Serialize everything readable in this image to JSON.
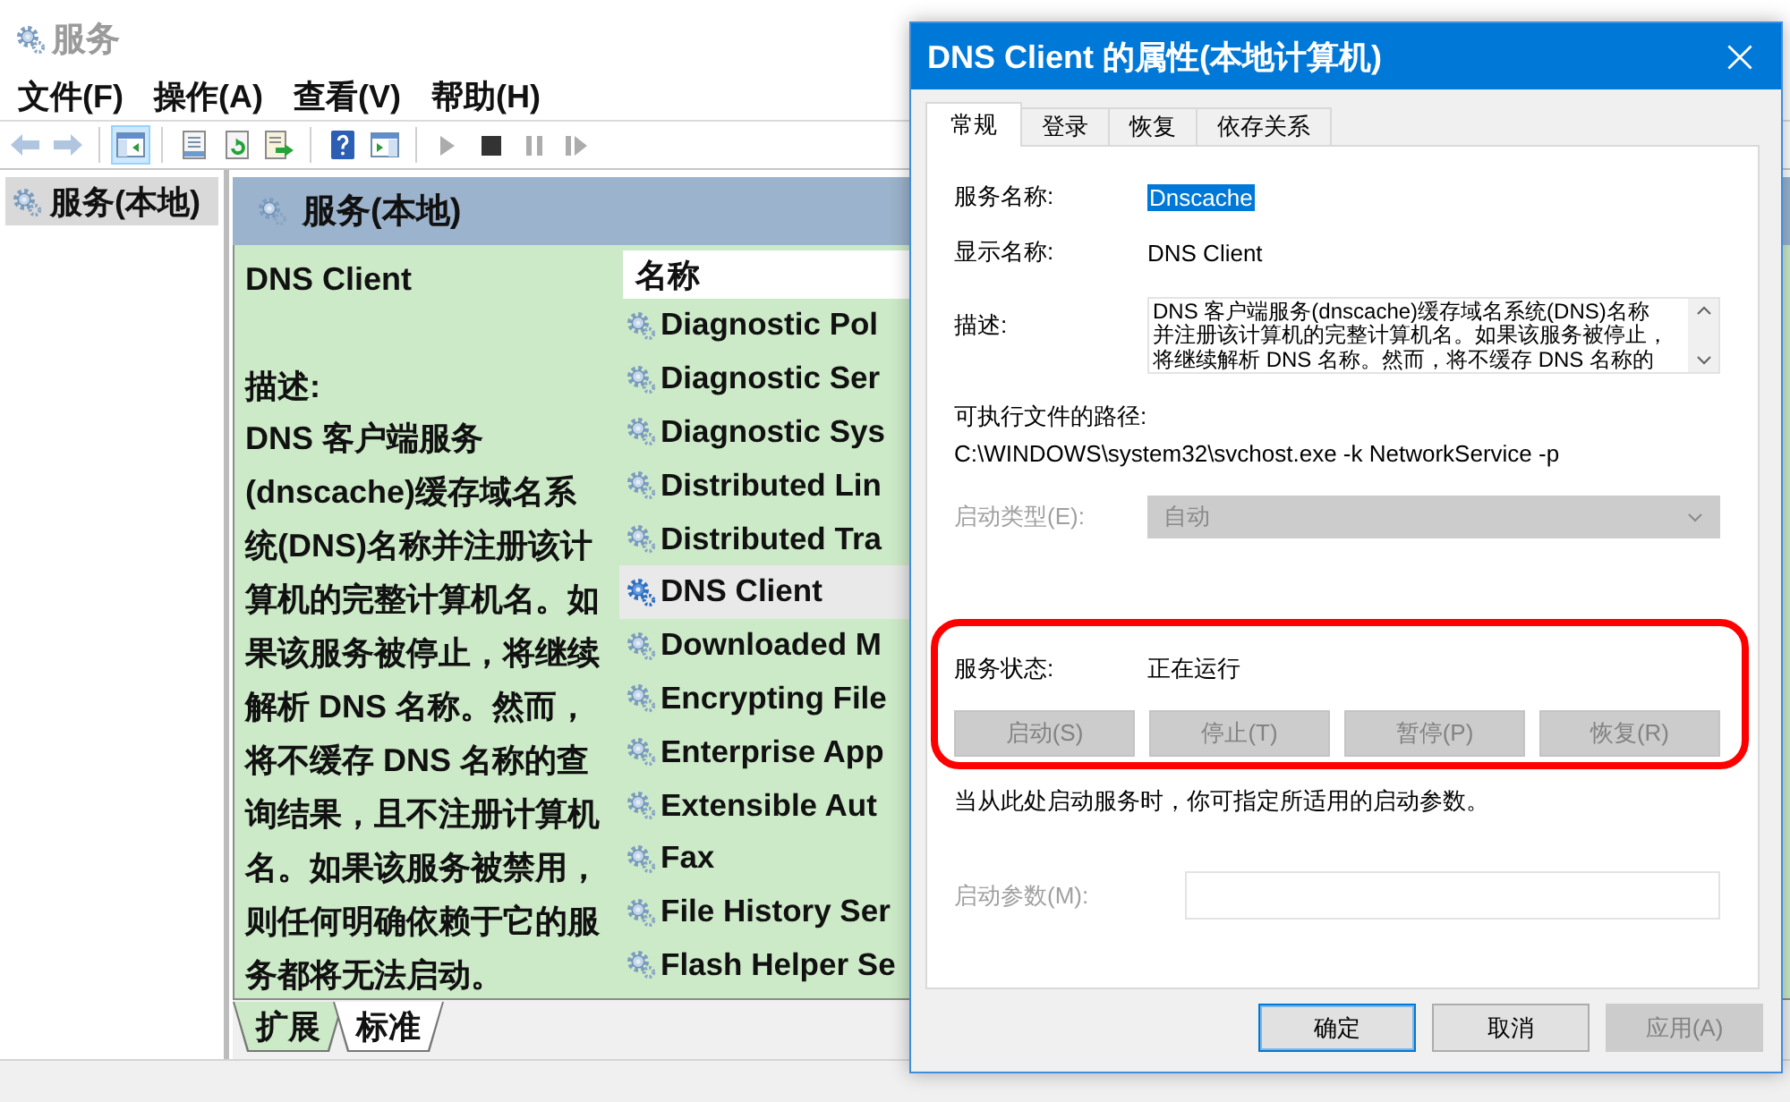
{
  "window": {
    "title": "服务"
  },
  "menu": [
    "文件(F)",
    "操作(A)",
    "查看(V)",
    "帮助(H)"
  ],
  "toolbar": {
    "groups": [
      [
        {
          "kind": "back",
          "disabled": true,
          "pressed": false
        },
        {
          "kind": "forward",
          "disabled": true,
          "pressed": false
        }
      ],
      [
        {
          "kind": "tree_pane",
          "disabled": false,
          "pressed": true
        }
      ],
      [
        {
          "kind": "properties",
          "disabled": false,
          "pressed": false
        },
        {
          "kind": "refresh",
          "disabled": false,
          "pressed": false
        },
        {
          "kind": "export",
          "disabled": false,
          "pressed": false
        }
      ],
      [
        {
          "kind": "help",
          "disabled": false,
          "pressed": false
        },
        {
          "kind": "action_pane",
          "disabled": false,
          "pressed": false
        }
      ],
      [
        {
          "kind": "start",
          "disabled": true,
          "pressed": false
        },
        {
          "kind": "stop",
          "disabled": false,
          "pressed": false
        },
        {
          "kind": "pause",
          "disabled": true,
          "pressed": false
        },
        {
          "kind": "resume",
          "disabled": true,
          "pressed": false
        }
      ]
    ]
  },
  "tree": {
    "items": [
      {
        "label": "服务(本地)",
        "selected": true
      }
    ]
  },
  "pane": {
    "title": "服务(本地)",
    "detail": {
      "name": "DNS Client",
      "description_label": "描述:",
      "description": "DNS 客户端服务(dnscache)缓存域名系统(DNS)名称并注册该计算机的完整计算机名。如果该服务被停止，将继续解析 DNS 名称。然而，将不缓存 DNS 名称的查询结果，且不注册计算机名。如果该服务被禁用，则任何明确依赖于它的服务都将无法启动。"
    },
    "list": {
      "columns": [
        "名称"
      ],
      "rows": [
        {
          "name": "Diagnostic Pol",
          "selected": false
        },
        {
          "name": "Diagnostic Ser",
          "selected": false
        },
        {
          "name": "Diagnostic Sys",
          "selected": false
        },
        {
          "name": "Distributed Lin",
          "selected": false
        },
        {
          "name": "Distributed Tra",
          "selected": false
        },
        {
          "name": "DNS Client",
          "selected": true
        },
        {
          "name": "Downloaded M",
          "selected": false
        },
        {
          "name": "Encrypting File",
          "selected": false
        },
        {
          "name": "Enterprise App",
          "selected": false
        },
        {
          "name": "Extensible Aut",
          "selected": false
        },
        {
          "name": "Fax",
          "selected": false
        },
        {
          "name": "File History Ser",
          "selected": false
        },
        {
          "name": "Flash Helper Se",
          "selected": false
        }
      ]
    },
    "view_tabs": [
      {
        "label": "扩展",
        "selected": true
      },
      {
        "label": "标准",
        "selected": false
      }
    ]
  },
  "dialog": {
    "title": "DNS Client 的属性(本地计算机)",
    "tabs": [
      {
        "label": "常规",
        "selected": true
      },
      {
        "label": "登录",
        "selected": false
      },
      {
        "label": "恢复",
        "selected": false
      },
      {
        "label": "依存关系",
        "selected": false
      }
    ],
    "service_name": {
      "label": "服务名称:",
      "value": "Dnscache",
      "text_selected": true
    },
    "display_name": {
      "label": "显示名称:",
      "value": "DNS Client"
    },
    "description": {
      "label": "描述:",
      "lines": [
        "DNS 客户端服务(dnscache)缓存域名系统(DNS)名称",
        "并注册该计算机的完整计算机名。如果该服务被停止，",
        "将继续解析 DNS 名称。然而，将不缓存 DNS 名称的"
      ]
    },
    "executable_path": {
      "label": "可执行文件的路径:",
      "value": "C:\\WINDOWS\\system32\\svchost.exe -k NetworkService -p"
    },
    "startup_type": {
      "label": "启动类型(E):",
      "value": "自动",
      "disabled": true
    },
    "service_status": {
      "label": "服务状态:",
      "value": "正在运行"
    },
    "status_buttons": [
      {
        "label": "启动(S)",
        "disabled": true
      },
      {
        "label": "停止(T)",
        "disabled": true
      },
      {
        "label": "暂停(P)",
        "disabled": true
      },
      {
        "label": "恢复(R)",
        "disabled": true
      }
    ],
    "start_hint": "当从此处启动服务时，你可指定所适用的启动参数。",
    "start_parameters": {
      "label": "启动参数(M):",
      "disabled": true
    },
    "buttons": [
      {
        "label": "确定",
        "default": true,
        "disabled": false
      },
      {
        "label": "取消",
        "default": false,
        "disabled": false
      },
      {
        "label": "应用(A)",
        "default": false,
        "disabled": true
      }
    ]
  }
}
